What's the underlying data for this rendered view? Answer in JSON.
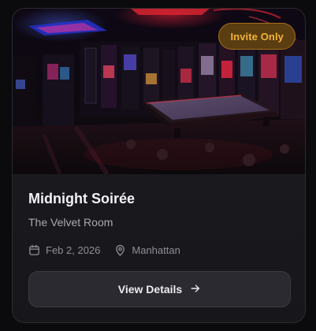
{
  "event": {
    "badge": "Invite Only",
    "title": "Midnight Soirée",
    "venue": "The Velvet Room",
    "date": "Feb 2, 2026",
    "location": "Manhattan"
  },
  "actions": {
    "details_label": "View Details"
  },
  "icons": {
    "date": "calendar-icon",
    "location": "map-pin-icon",
    "arrow": "arrow-right-icon"
  },
  "colors": {
    "badge_text": "#f2b23a",
    "badge_bg": "#5a3d10",
    "card_bg": "#1c1c21",
    "button_bg": "#2a2a30"
  }
}
